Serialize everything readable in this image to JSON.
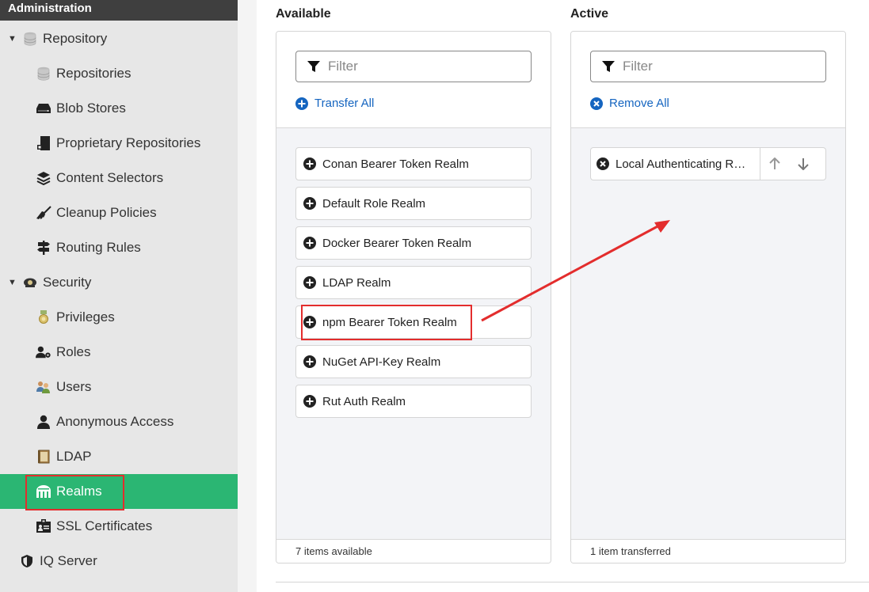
{
  "sidebar": {
    "header": "Administration",
    "items": [
      {
        "label": "Repository",
        "icon": "database-icon",
        "level": 1,
        "expanded": true
      },
      {
        "label": "Repositories",
        "icon": "database-icon",
        "level": 2
      },
      {
        "label": "Blob Stores",
        "icon": "hard-drive-icon",
        "level": 2
      },
      {
        "label": "Proprietary Repositories",
        "icon": "proprietary-icon",
        "level": 2
      },
      {
        "label": "Content Selectors",
        "icon": "layers-icon",
        "level": 2
      },
      {
        "label": "Cleanup Policies",
        "icon": "broom-icon",
        "level": 2
      },
      {
        "label": "Routing Rules",
        "icon": "signpost-icon",
        "level": 2
      },
      {
        "label": "Security",
        "icon": "security-icon",
        "level": 1,
        "expanded": true
      },
      {
        "label": "Privileges",
        "icon": "medal-icon",
        "level": 2
      },
      {
        "label": "Roles",
        "icon": "user-gear-icon",
        "level": 2
      },
      {
        "label": "Users",
        "icon": "users-icon",
        "level": 2
      },
      {
        "label": "Anonymous Access",
        "icon": "user-icon",
        "level": 2
      },
      {
        "label": "LDAP",
        "icon": "book-icon",
        "level": 2
      },
      {
        "label": "Realms",
        "icon": "realm-gate-icon",
        "level": 2,
        "active": true
      },
      {
        "label": "SSL Certificates",
        "icon": "certificate-icon",
        "level": 2
      },
      {
        "label": "IQ Server",
        "icon": "shield-icon",
        "level": 1
      }
    ]
  },
  "available": {
    "title": "Available",
    "filter_placeholder": "Filter",
    "action_label": "Transfer All",
    "items": [
      "Conan Bearer Token Realm",
      "Default Role Realm",
      "Docker Bearer Token Realm",
      "LDAP Realm",
      "npm Bearer Token Realm",
      "NuGet API-Key Realm",
      "Rut Auth Realm"
    ],
    "footer": "7 items available"
  },
  "active": {
    "title": "Active",
    "filter_placeholder": "Filter",
    "action_label": "Remove All",
    "items": [
      "Local Authenticating Realm"
    ],
    "footer": "1 item transferred"
  },
  "colors": {
    "accent_green": "#2bb673",
    "link_blue": "#1565c0",
    "annotation_red": "#e32d2d",
    "sidebar_bg": "#e7e7e7",
    "header_bg": "#3f3f3f"
  }
}
